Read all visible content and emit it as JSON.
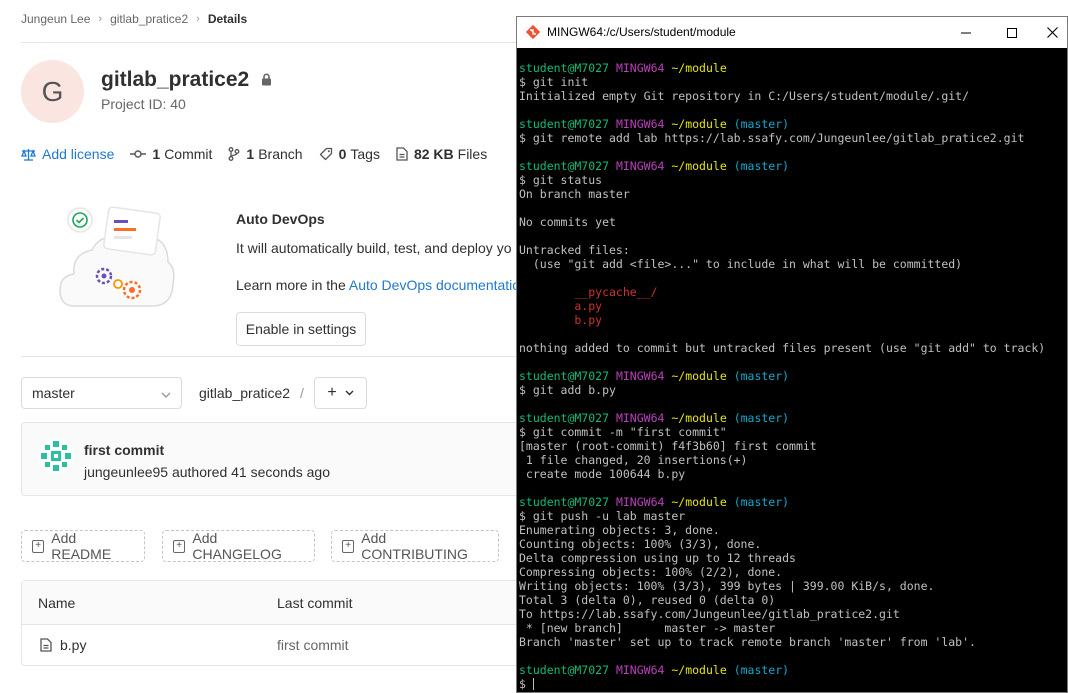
{
  "gitlab": {
    "breadcrumb": {
      "user": "Jungeun Lee",
      "project": "gitlab_pratice2",
      "current": "Details"
    },
    "project": {
      "avatar_letter": "G",
      "name": "gitlab_pratice2",
      "id_label": "Project ID: 40"
    },
    "stats": {
      "license": "Add license",
      "commits_count": "1",
      "commits_label": "Commit",
      "branches_count": "1",
      "branches_label": "Branch",
      "tags_count": "0",
      "tags_label": "Tags",
      "files_size": "82 KB",
      "files_label": "Files"
    },
    "devops": {
      "title": "Auto DevOps",
      "text": "It will automatically build, test, and deploy yo",
      "learn_prefix": "Learn more in the ",
      "learn_link": "Auto DevOps documentatio",
      "enable_button": "Enable in settings"
    },
    "repo": {
      "branch": "master",
      "path": "gitlab_pratice2",
      "path_sep": "/",
      "plus": "+"
    },
    "last_commit": {
      "title": "first commit",
      "meta": "jungeunlee95 authored 41 seconds ago"
    },
    "add_buttons": [
      "Add README",
      "Add CHANGELOG",
      "Add CONTRIBUTING"
    ],
    "file_table": {
      "col_name": "Name",
      "col_last_commit": "Last commit",
      "rows": [
        {
          "name": "b.py",
          "last_commit": "first commit"
        }
      ]
    }
  },
  "terminal": {
    "title": "MINGW64:/c/Users/student/module",
    "prompt": {
      "user": "student@M7027",
      "host": "MINGW64",
      "path": "~/module",
      "branch": "(master)"
    },
    "lines": [
      {
        "kind": "prompt",
        "branch": false
      },
      {
        "kind": "text",
        "text": "$ git init"
      },
      {
        "kind": "text",
        "text": "Initialized empty Git repository in C:/Users/student/module/.git/"
      },
      {
        "kind": "blank"
      },
      {
        "kind": "prompt",
        "branch": true
      },
      {
        "kind": "text",
        "text": "$ git remote add lab https://lab.ssafy.com/Jungeunlee/gitlab_pratice2.git"
      },
      {
        "kind": "blank"
      },
      {
        "kind": "prompt",
        "branch": true
      },
      {
        "kind": "text",
        "text": "$ git status"
      },
      {
        "kind": "text",
        "text": "On branch master"
      },
      {
        "kind": "blank"
      },
      {
        "kind": "text",
        "text": "No commits yet"
      },
      {
        "kind": "blank"
      },
      {
        "kind": "text",
        "text": "Untracked files:"
      },
      {
        "kind": "text",
        "text": "  (use \"git add <file>...\" to include in what will be committed)"
      },
      {
        "kind": "blank"
      },
      {
        "kind": "red",
        "text": "        __pycache__/"
      },
      {
        "kind": "red",
        "text": "        a.py"
      },
      {
        "kind": "red",
        "text": "        b.py"
      },
      {
        "kind": "blank"
      },
      {
        "kind": "text",
        "text": "nothing added to commit but untracked files present (use \"git add\" to track)"
      },
      {
        "kind": "blank"
      },
      {
        "kind": "prompt",
        "branch": true
      },
      {
        "kind": "text",
        "text": "$ git add b.py"
      },
      {
        "kind": "blank"
      },
      {
        "kind": "prompt",
        "branch": true
      },
      {
        "kind": "text",
        "text": "$ git commit -m \"first commit\""
      },
      {
        "kind": "text",
        "text": "[master (root-commit) f4f3b60] first commit"
      },
      {
        "kind": "text",
        "text": " 1 file changed, 20 insertions(+)"
      },
      {
        "kind": "text",
        "text": " create mode 100644 b.py"
      },
      {
        "kind": "blank"
      },
      {
        "kind": "prompt",
        "branch": true
      },
      {
        "kind": "text",
        "text": "$ git push -u lab master"
      },
      {
        "kind": "text",
        "text": "Enumerating objects: 3, done."
      },
      {
        "kind": "text",
        "text": "Counting objects: 100% (3/3), done."
      },
      {
        "kind": "text",
        "text": "Delta compression using up to 12 threads"
      },
      {
        "kind": "text",
        "text": "Compressing objects: 100% (2/2), done."
      },
      {
        "kind": "text",
        "text": "Writing objects: 100% (3/3), 399 bytes | 399.00 KiB/s, done."
      },
      {
        "kind": "text",
        "text": "Total 3 (delta 0), reused 0 (delta 0)"
      },
      {
        "kind": "text",
        "text": "To https://lab.ssafy.com/Jungeunlee/gitlab_pratice2.git"
      },
      {
        "kind": "text",
        "text": " * [new branch]      master -> master"
      },
      {
        "kind": "text",
        "text": "Branch 'master' set up to track remote branch 'master' from 'lab'."
      },
      {
        "kind": "blank"
      },
      {
        "kind": "prompt",
        "branch": true
      },
      {
        "kind": "cursor",
        "text": "$ "
      }
    ]
  }
}
